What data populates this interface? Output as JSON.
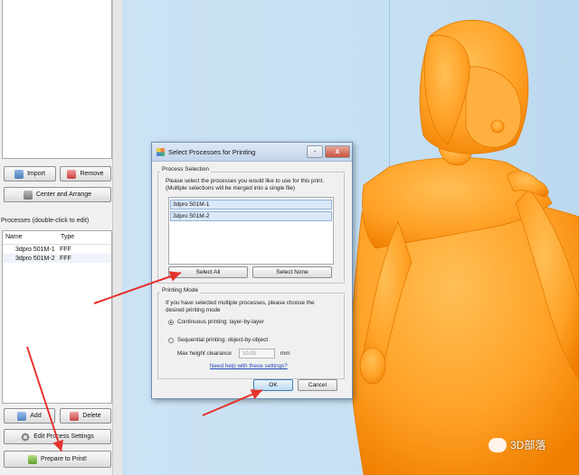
{
  "left_panel": {
    "import_label": "Import",
    "remove_label": "Remove",
    "center_arrange_label": "Center and Arrange",
    "processes_title": "Processes (double-click to edit)",
    "columns": [
      "Name",
      "Type"
    ],
    "processes": [
      {
        "name": "3dpro 501M-1",
        "type": "FFF"
      },
      {
        "name": "3dpro 501M-2",
        "type": "FFF"
      }
    ],
    "add_label": "Add",
    "delete_label": "Delete",
    "edit_process_label": "Edit Process Settings",
    "prepare_label": "Prepare to Print!"
  },
  "dialog": {
    "title": "Select Processes for Printing",
    "minimize": "-",
    "close": "x",
    "process_selection_label": "Process Selection",
    "process_desc_line1": "Please select the processes you would like to use for this print.",
    "process_desc_line2": "(Multiple selections will be merged into a single file)",
    "process_items": [
      "3dpro 501M-1",
      "3dpro 501M-2"
    ],
    "select_all_label": "Select All",
    "select_none_label": "Select None",
    "printing_mode_label": "Printing Mode",
    "mode_desc_line1": "If you have selected multiple processes, please choose the",
    "mode_desc_line2": "desired printing mode",
    "continuous_label": "Continuous printing: layer-by-layer",
    "sequential_label": "Sequential printing: object-by-object",
    "max_height_label": "Max height clearance",
    "max_height_value": "10.00",
    "max_height_unit": "mm",
    "help_link": "Need help with these settings?",
    "ok_label": "OK",
    "cancel_label": "Cancel"
  },
  "watermark": {
    "text": "3D部落"
  },
  "colors": {
    "figure": "#ffa126",
    "figure_shadow": "#f07f00",
    "viewport": "#c9e2f4",
    "arrow": "#e6322c"
  }
}
